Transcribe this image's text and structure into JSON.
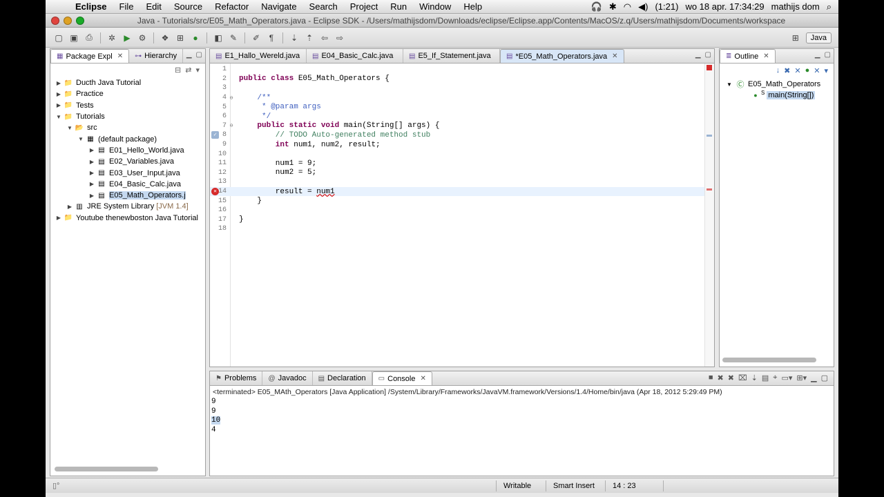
{
  "menubar": {
    "app": "Eclipse",
    "items": [
      "File",
      "Edit",
      "Source",
      "Refactor",
      "Navigate",
      "Search",
      "Project",
      "Run",
      "Window",
      "Help"
    ],
    "battery": "(1:21)",
    "clock": "wo 18 apr.  17:34:29",
    "user": "mathijs dom"
  },
  "window": {
    "title": "Java - Tutorials/src/E05_Math_Operators.java - Eclipse SDK - /Users/mathijsdom/Downloads/eclipse/Eclipse.app/Contents/MacOS/z.q/Users/mathijsdom/Documents/workspace",
    "perspective": "Java"
  },
  "package_explorer": {
    "tabs": [
      "Package Expl",
      "Hierarchy"
    ],
    "tree": [
      {
        "label": "Ducth Java Tutorial",
        "level": 0,
        "toggle": "▶",
        "icon": "project-icon"
      },
      {
        "label": "Practice",
        "level": 0,
        "toggle": "▶",
        "icon": "project-icon"
      },
      {
        "label": "Tests",
        "level": 0,
        "toggle": "▶",
        "icon": "project-icon"
      },
      {
        "label": "Tutorials",
        "level": 0,
        "toggle": "▼",
        "icon": "project-icon"
      },
      {
        "label": "src",
        "level": 1,
        "toggle": "▼",
        "icon": "source-folder-icon"
      },
      {
        "label": "(default package)",
        "level": 2,
        "toggle": "▼",
        "icon": "package-icon"
      },
      {
        "label": "E01_Hello_World.java",
        "level": 3,
        "toggle": "▶",
        "icon": "java-file-icon"
      },
      {
        "label": "E02_Variables.java",
        "level": 3,
        "toggle": "▶",
        "icon": "java-file-icon"
      },
      {
        "label": "E03_User_Input.java",
        "level": 3,
        "toggle": "▶",
        "icon": "java-file-icon"
      },
      {
        "label": "E04_Basic_Calc.java",
        "level": 3,
        "toggle": "▶",
        "icon": "java-file-icon"
      },
      {
        "label": "E05_Math_Operators.j",
        "level": 3,
        "toggle": "▶",
        "icon": "java-file-icon",
        "selected": true
      },
      {
        "label": "JRE System Library",
        "suffix": "[JVM 1.4]",
        "level": 1,
        "toggle": "▶",
        "icon": "library-icon"
      },
      {
        "label": "Youtube thenewboston Java Tutorial",
        "level": 0,
        "toggle": "▶",
        "icon": "project-icon"
      }
    ]
  },
  "editor": {
    "tabs": [
      {
        "label": "E1_Hallo_Wereld.java",
        "active": false
      },
      {
        "label": "E04_Basic_Calc.java",
        "active": false
      },
      {
        "label": "E5_If_Statement.java",
        "active": false
      },
      {
        "label": "*E05_Math_Operators.java",
        "active": true
      }
    ],
    "lines": [
      {
        "n": "1",
        "parts": []
      },
      {
        "n": "2",
        "parts": [
          {
            "t": "public class",
            "c": "kw"
          },
          {
            "t": " E05_Math_Operators {",
            "c": ""
          }
        ]
      },
      {
        "n": "3",
        "parts": []
      },
      {
        "n": "4",
        "fold": "⊖",
        "parts": [
          {
            "t": "    /**",
            "c": "jd"
          }
        ]
      },
      {
        "n": "5",
        "parts": [
          {
            "t": "     * @param args",
            "c": "jd"
          }
        ]
      },
      {
        "n": "6",
        "parts": [
          {
            "t": "     */",
            "c": "jd"
          }
        ]
      },
      {
        "n": "7",
        "fold": "⊖",
        "parts": [
          {
            "t": "    public static void",
            "c": "kw"
          },
          {
            "t": " main(String[] args) {",
            "c": ""
          }
        ]
      },
      {
        "n": "8",
        "marker": "task",
        "parts": [
          {
            "t": "        // TODO Auto-generated method stub",
            "c": "cm"
          }
        ]
      },
      {
        "n": "9",
        "parts": [
          {
            "t": "        int",
            "c": "kw"
          },
          {
            "t": " num1, num2, result;",
            "c": ""
          }
        ]
      },
      {
        "n": "10",
        "parts": []
      },
      {
        "n": "11",
        "parts": [
          {
            "t": "        num1 = 9;",
            "c": ""
          }
        ]
      },
      {
        "n": "12",
        "parts": [
          {
            "t": "        num2 = 5;",
            "c": ""
          }
        ]
      },
      {
        "n": "13",
        "parts": []
      },
      {
        "n": "14",
        "marker": "error",
        "current": true,
        "parts": [
          {
            "t": "        result = ",
            "c": ""
          },
          {
            "t": "num1",
            "c": "err"
          }
        ]
      },
      {
        "n": "15",
        "parts": [
          {
            "t": "    }",
            "c": ""
          }
        ]
      },
      {
        "n": "16",
        "parts": []
      },
      {
        "n": "17",
        "parts": [
          {
            "t": "}",
            "c": ""
          }
        ]
      },
      {
        "n": "18",
        "parts": []
      }
    ]
  },
  "outline": {
    "tab": "Outline",
    "class_name": "E05_Math_Operators",
    "method": "main(String[])",
    "static_marker": "S"
  },
  "console": {
    "tabs": [
      {
        "label": "Problems",
        "active": false
      },
      {
        "label": "Javadoc",
        "active": false
      },
      {
        "label": "Declaration",
        "active": false
      },
      {
        "label": "Console",
        "active": true
      }
    ],
    "header": "<terminated> E05_MAth_Operators [Java Application] /System/Library/Frameworks/JavaVM.framework/Versions/1.4/Home/bin/java (Apr 18, 2012 5:29:49 PM)",
    "output": [
      "9",
      "9",
      "10",
      "4"
    ],
    "highlight_index": 2
  },
  "status": {
    "writable": "Writable",
    "insert_mode": "Smart Insert",
    "position": "14 : 23"
  },
  "colors": {
    "keyword": "#7f0055",
    "comment": "#3f7f5f",
    "javadoc": "#3f5fbf",
    "error": "#d62a2a",
    "selection": "#c5d9f0"
  }
}
